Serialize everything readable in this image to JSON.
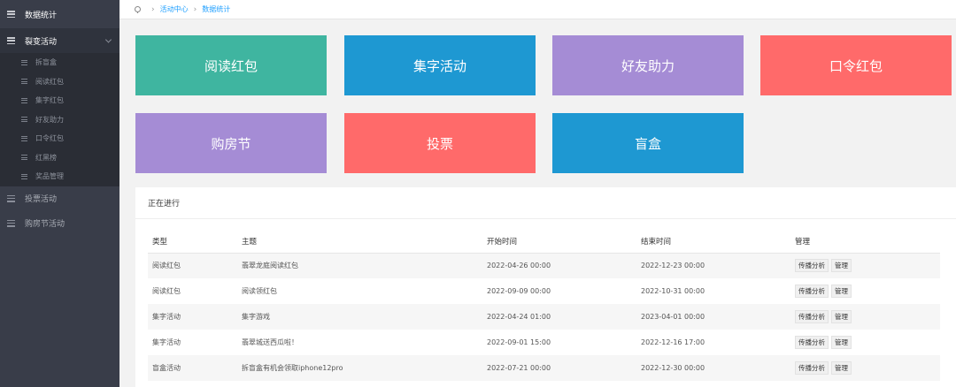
{
  "sidebar": {
    "items": [
      {
        "label": "数据统计"
      },
      {
        "label": "裂变活动"
      },
      {
        "label": "投票活动"
      },
      {
        "label": "购房节活动"
      }
    ],
    "subitems": [
      {
        "label": "拆盲盒"
      },
      {
        "label": "阅读红包"
      },
      {
        "label": "集字红包"
      },
      {
        "label": "好友助力"
      },
      {
        "label": "口令红包"
      },
      {
        "label": "红黑榜"
      },
      {
        "label": "奖品管理"
      }
    ]
  },
  "breadcrumb": {
    "items": [
      {
        "label": "活动中心"
      },
      {
        "label": "数据统计"
      }
    ]
  },
  "tiles": [
    {
      "label": "阅读红包",
      "color": "#3fb5a0"
    },
    {
      "label": "集字活动",
      "color": "#1e98d2"
    },
    {
      "label": "好友助力",
      "color": "#a58cd5"
    },
    {
      "label": "口令红包",
      "color": "#ff6a6a"
    },
    {
      "label": "购房节",
      "color": "#a58cd5"
    },
    {
      "label": "投票",
      "color": "#ff6a6a"
    },
    {
      "label": "盲盒",
      "color": "#1e98d2"
    }
  ],
  "ongoing": {
    "title": "正在进行",
    "columns": [
      "类型",
      "主题",
      "开始时间",
      "结束时间",
      "管理"
    ],
    "rows": [
      {
        "type": "阅读红包",
        "subject": "翡翠龙庭阅读红包",
        "start": "2022-04-26 00:00",
        "end": "2022-12-23 00:00"
      },
      {
        "type": "阅读红包",
        "subject": "阅读领红包",
        "start": "2022-09-09 00:00",
        "end": "2022-10-31 00:00"
      },
      {
        "type": "集字活动",
        "subject": "集字游戏",
        "start": "2022-04-24 01:00",
        "end": "2023-04-01 00:00"
      },
      {
        "type": "集字活动",
        "subject": "翡翠城送西瓜啦！",
        "start": "2022-09-01 15:00",
        "end": "2022-12-16 17:00"
      },
      {
        "type": "盲盒活动",
        "subject": "拆盲盒有机会领取iphone12pro",
        "start": "2022-07-21 00:00",
        "end": "2022-12-30 00:00"
      }
    ],
    "actions": {
      "analysis": "传播分析",
      "manage": "管理"
    }
  }
}
